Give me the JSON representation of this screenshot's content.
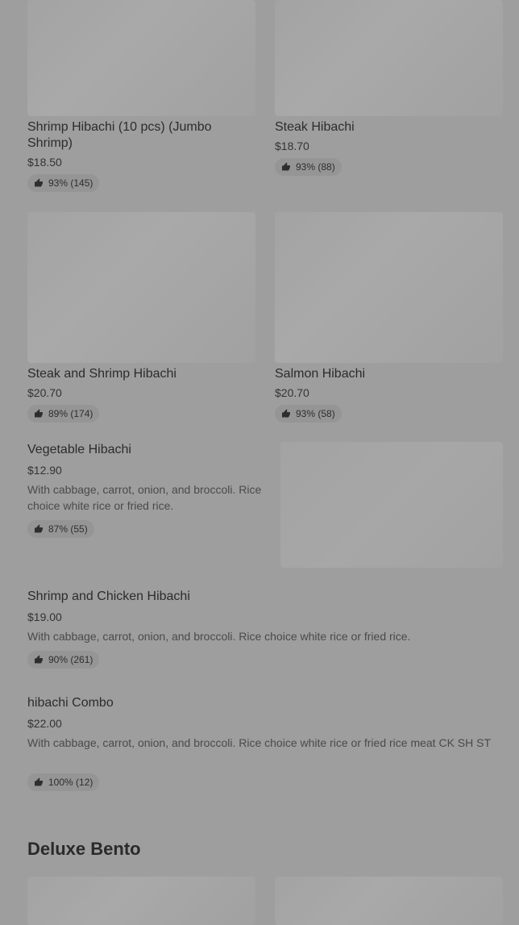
{
  "grid_items": [
    {
      "name": "Shrimp Hibachi (10 pcs) (Jumbo Shrimp)",
      "price": "$18.50",
      "rating": "93% (145)"
    },
    {
      "name": "Steak Hibachi",
      "price": "$18.70",
      "rating": "93% (88)"
    },
    {
      "name": "Steak and Shrimp Hibachi",
      "price": "$20.70",
      "rating": "89% (174)"
    },
    {
      "name": "Salmon Hibachi",
      "price": "$20.70",
      "rating": "93% (58)"
    }
  ],
  "list_items": [
    {
      "name": "Vegetable Hibachi",
      "price": "$12.90",
      "description": "With cabbage, carrot, onion, and broccoli. Rice choice white rice or fried rice.",
      "rating": "87% (55)"
    },
    {
      "name": "Shrimp and Chicken Hibachi",
      "price": "$19.00",
      "description": "With cabbage, carrot, onion, and broccoli. Rice choice white rice or fried rice.",
      "rating": "90% (261)"
    },
    {
      "name": "hibachi Combo",
      "price": "$22.00",
      "description": "With cabbage, carrot, onion, and broccoli. Rice choice white rice or fried rice meat CK SH ST",
      "rating": "100% (12)"
    }
  ],
  "section": {
    "title": "Deluxe Bento"
  },
  "icons": {
    "thumb": "thumbs-up-icon"
  }
}
